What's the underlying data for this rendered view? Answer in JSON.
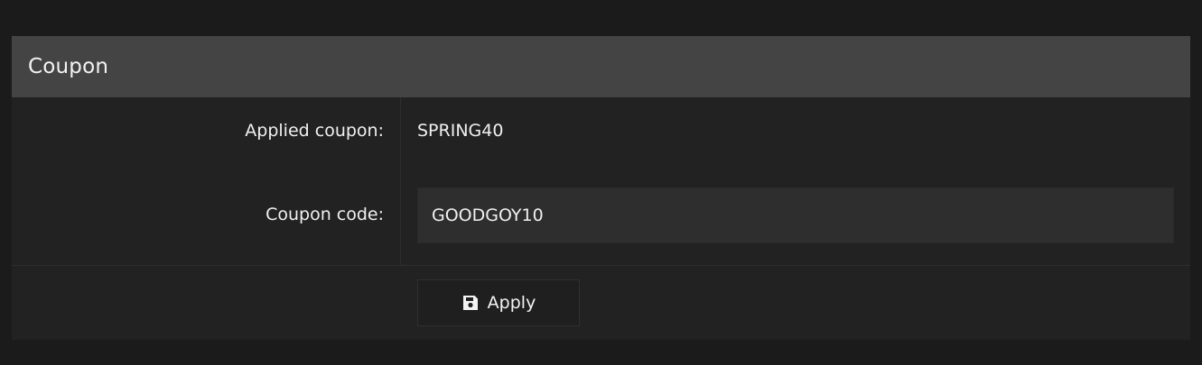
{
  "panel": {
    "title": "Coupon"
  },
  "applied_coupon": {
    "label": "Applied coupon:",
    "value": "SPRING40"
  },
  "coupon_code": {
    "label": "Coupon code:",
    "value": "GOODGOY10"
  },
  "apply_button": {
    "label": "Apply",
    "icon": "floppy-disk-save-icon"
  },
  "colors": {
    "background": "#1b1b1b",
    "panel": "#222222",
    "header": "#444444",
    "input": "#2e2e2e",
    "text": "#f0f0f0"
  }
}
